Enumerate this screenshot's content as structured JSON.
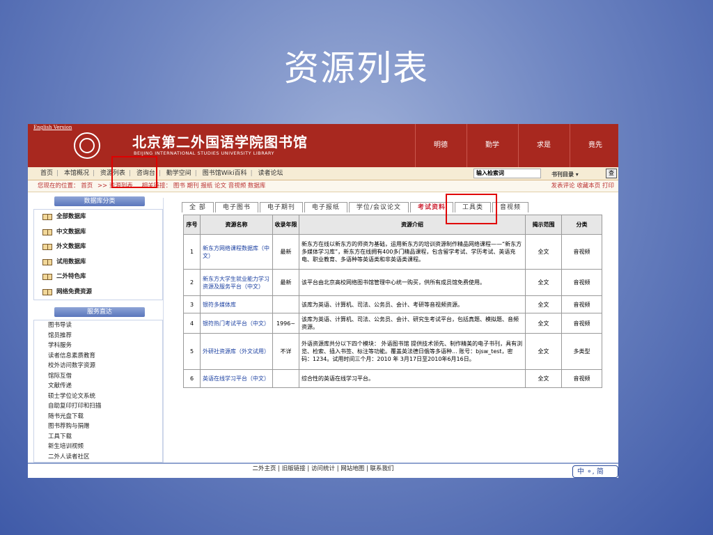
{
  "slide": {
    "title": "资源列表"
  },
  "header": {
    "english_link": "English Version",
    "library_name": "北京第二外国语学院图书馆",
    "library_name_en": "BEIJING INTERNATIONAL STUDIES UNIVERSITY LIBRARY",
    "motto": [
      "明德",
      "勤学",
      "求是",
      "竟先"
    ]
  },
  "nav": {
    "items": [
      "首页",
      "本馆概况",
      "资源列表",
      "咨询台",
      "勤学空间",
      "图书馆Wiki百科",
      "读者论坛"
    ],
    "search_placeholder": "输入检索词",
    "catalog_select": "书刊目录",
    "go_button": "查"
  },
  "breadcrumb": {
    "label": "您现在的位置：",
    "home": "首页",
    "current": ">> 资源列表",
    "related_label": "相关链接：",
    "related": [
      "图书",
      "期刊",
      "报纸",
      "论文",
      "音视频",
      "数据库"
    ],
    "right_links": [
      "发表评论",
      "收藏本页",
      "打印"
    ]
  },
  "sidebar": {
    "db_header": "数据库分类",
    "db_items": [
      "全部数据库",
      "中文数据库",
      "外文数据库",
      "试用数据库",
      "二外特色库",
      "网络免费资源"
    ],
    "svc_header": "服务直达",
    "svc_items": [
      "图书导读",
      "馆员推荐",
      "学科服务",
      "读者信息素质教育",
      "校外访问数字资源",
      "馆际互借",
      "文献传递",
      "硕士学位论文系统",
      "自助复印打印和扫描",
      "随书光盘下载",
      "图书荐购与捐赠",
      "工具下载",
      "新生培训视频",
      "二外人读者社区"
    ]
  },
  "tabs": [
    "全 部",
    "电子图书",
    "电子期刊",
    "电子报纸",
    "学位/会议论文",
    "考试资料",
    "工具类",
    "音视频"
  ],
  "table": {
    "headers": [
      "序号",
      "资源名称",
      "收录年限",
      "资源介绍",
      "揭示范围",
      "分类"
    ],
    "rows": [
      {
        "no": "1",
        "name": "新东方网络课程数据库（中文）",
        "years": "最新",
        "desc": "新东方在线以新东方的师资为基础，运用新东方的培训资源制作精品网络课程——“新东方多媒体学习库”，新东方在线拥有400多门精品课程，包含留学考试、学历考试、英语充电、职业教育、多语种等英语类和非英语类课程。",
        "scope": "全文",
        "cat": "音视频"
      },
      {
        "no": "2",
        "name": "新东方大学生就业能力学习资源及服务平台（中文）",
        "years": "最新",
        "desc": "该平台由北京高校网络图书馆管理中心统一购买，供所有成员馆免费使用。",
        "scope": "全文",
        "cat": "音视频"
      },
      {
        "no": "3",
        "name": "银符多媒体库",
        "years": "",
        "desc": "该库为英语、计算机、司法、公务员、会计、考研等音视频资源。",
        "scope": "全文",
        "cat": "音视频"
      },
      {
        "no": "4",
        "name": "银符热门考试平台（中文）",
        "years": "1996~",
        "desc": "该库为英语、计算机、司法、公务员、会计、研究生考试平台，包括真题、模拟题、音频资源。",
        "scope": "全文",
        "cat": "音视频"
      },
      {
        "no": "5",
        "name": "外研社资源库（外文试用）",
        "years": "不详",
        "desc": "外语资源库共分以下四个模块： 外语图书馆 提供技术领先、制作精美的电子书刊，具有浏览、检索、插入书签、标注等功能。覆盖英法德日俄等多语种... 账号：bjsw_test，密码：1234。试用时间三个月：2010 年 3月17日至2010年6月16日。",
        "scope": "全文",
        "cat": "多类型"
      },
      {
        "no": "6",
        "name": "英语在线学习平台（中文）",
        "years": "",
        "desc": "综合性的英语在线学习平台。",
        "scope": "全文",
        "cat": "音视频"
      }
    ]
  },
  "footer": {
    "links": "二外主页 | 旧版链接 | 访问统计 | 网站地图 | 联系我们"
  },
  "ime": {
    "label": "中 ⚬, 简"
  },
  "colors": {
    "header_red": "#a8281f",
    "highlight_red": "#e00000",
    "link_blue": "#1a3fa0"
  }
}
